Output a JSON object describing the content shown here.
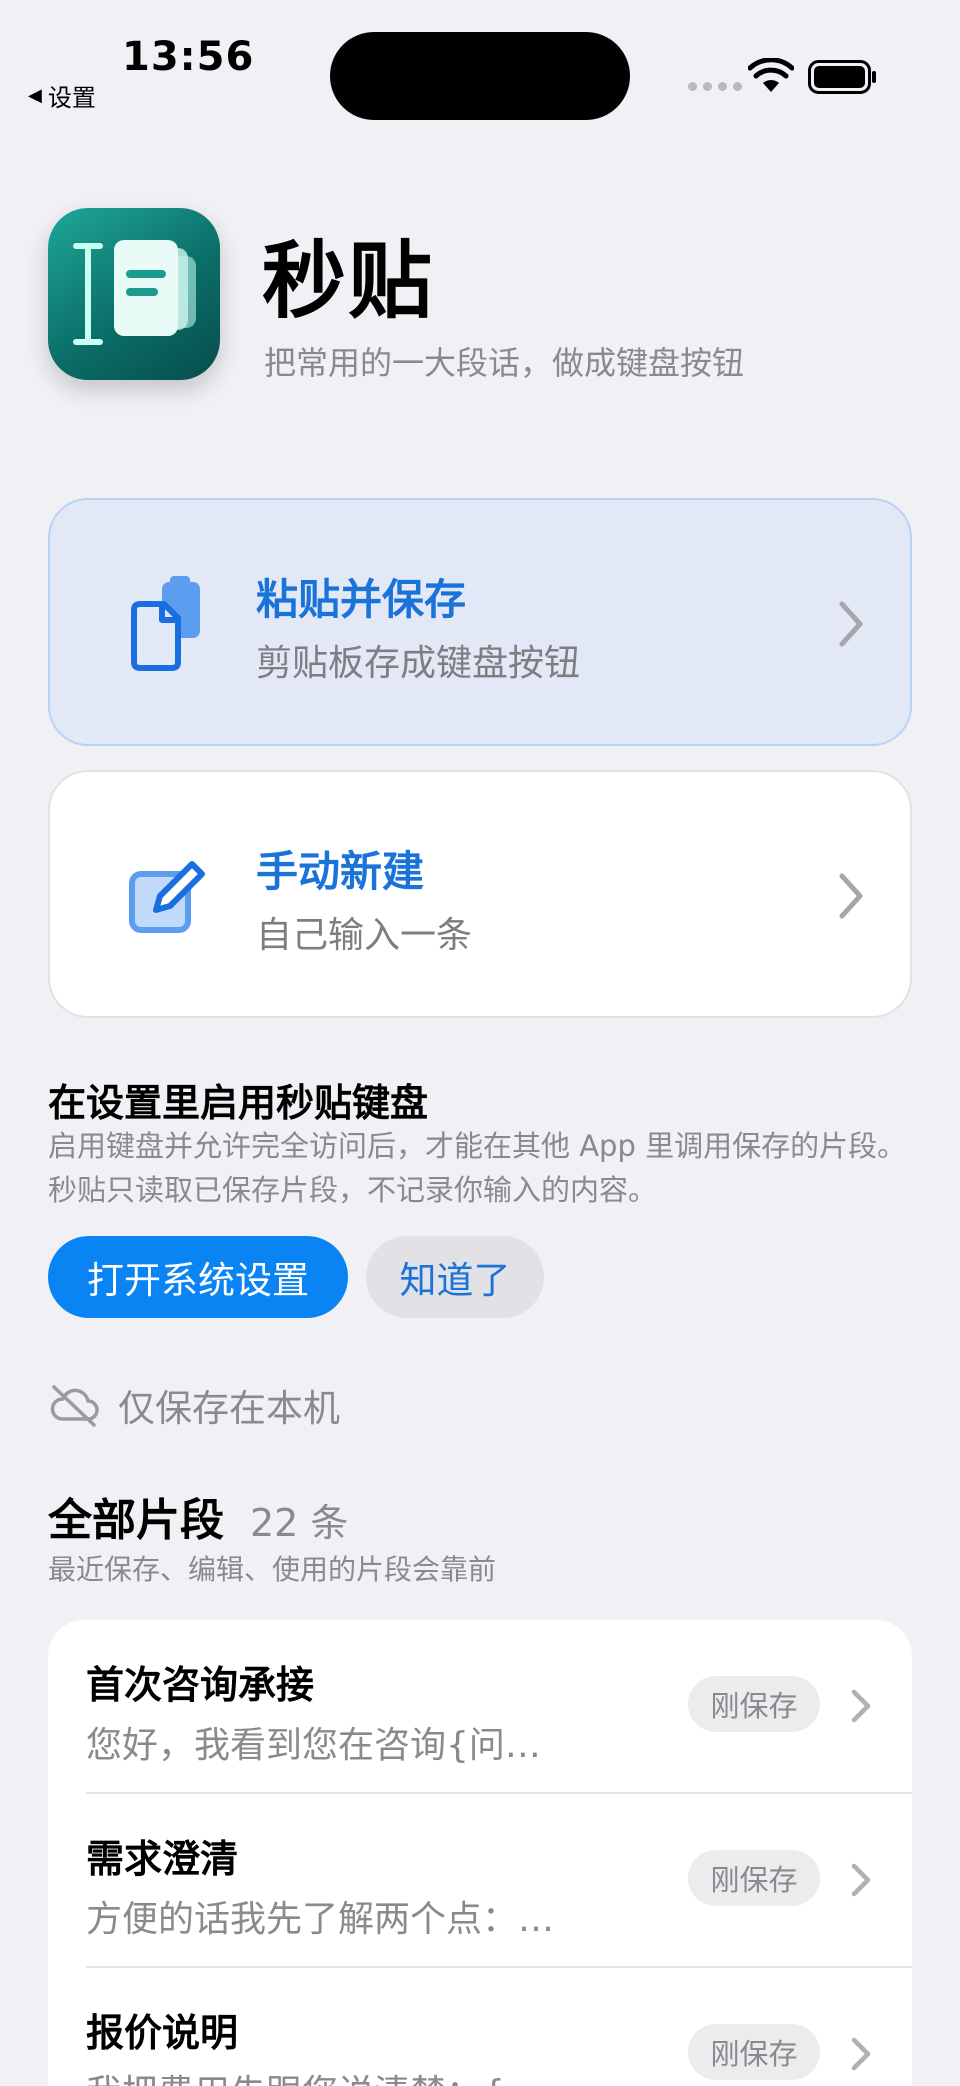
{
  "status_bar": {
    "time": "13:56",
    "back_label": "设置"
  },
  "header": {
    "app_name": "秒贴",
    "tagline": "把常用的一大段话，做成键盘按钮"
  },
  "actions": [
    {
      "title": "粘贴并保存",
      "subtitle": "剪贴板存成键盘按钮",
      "icon": "document-paste-icon"
    },
    {
      "title": "手动新建",
      "subtitle": "自己输入一条",
      "icon": "compose-icon"
    }
  ],
  "keyboard_setup": {
    "title": "在设置里启用秒贴键盘",
    "description": "启用键盘并允许完全访问后，才能在其他 App 里调用保存的片段。秒贴只读取已保存片段，不记录你输入的内容。",
    "primary_button": "打开系统设置",
    "secondary_button": "知道了"
  },
  "storage": {
    "label": "仅保存在本机",
    "icon": "cloud-off-icon"
  },
  "snippets_section": {
    "title": "全部片段",
    "count": "22 条",
    "subtitle": "最近保存、编辑、使用的片段会靠前"
  },
  "snippets": [
    {
      "title": "首次咨询承接",
      "preview": "您好，我看到您在咨询{问…",
      "badge": "刚保存"
    },
    {
      "title": "需求澄清",
      "preview": "方便的话我先了解两个点：…",
      "badge": "刚保存"
    },
    {
      "title": "报价说明",
      "preview": "我把费用先跟您说清楚：{",
      "badge": "刚保存"
    }
  ],
  "colors": {
    "accent": "#0a84f2",
    "link": "#1a73d9",
    "background": "#f0f0f5",
    "app_icon": "#0b6e68"
  }
}
